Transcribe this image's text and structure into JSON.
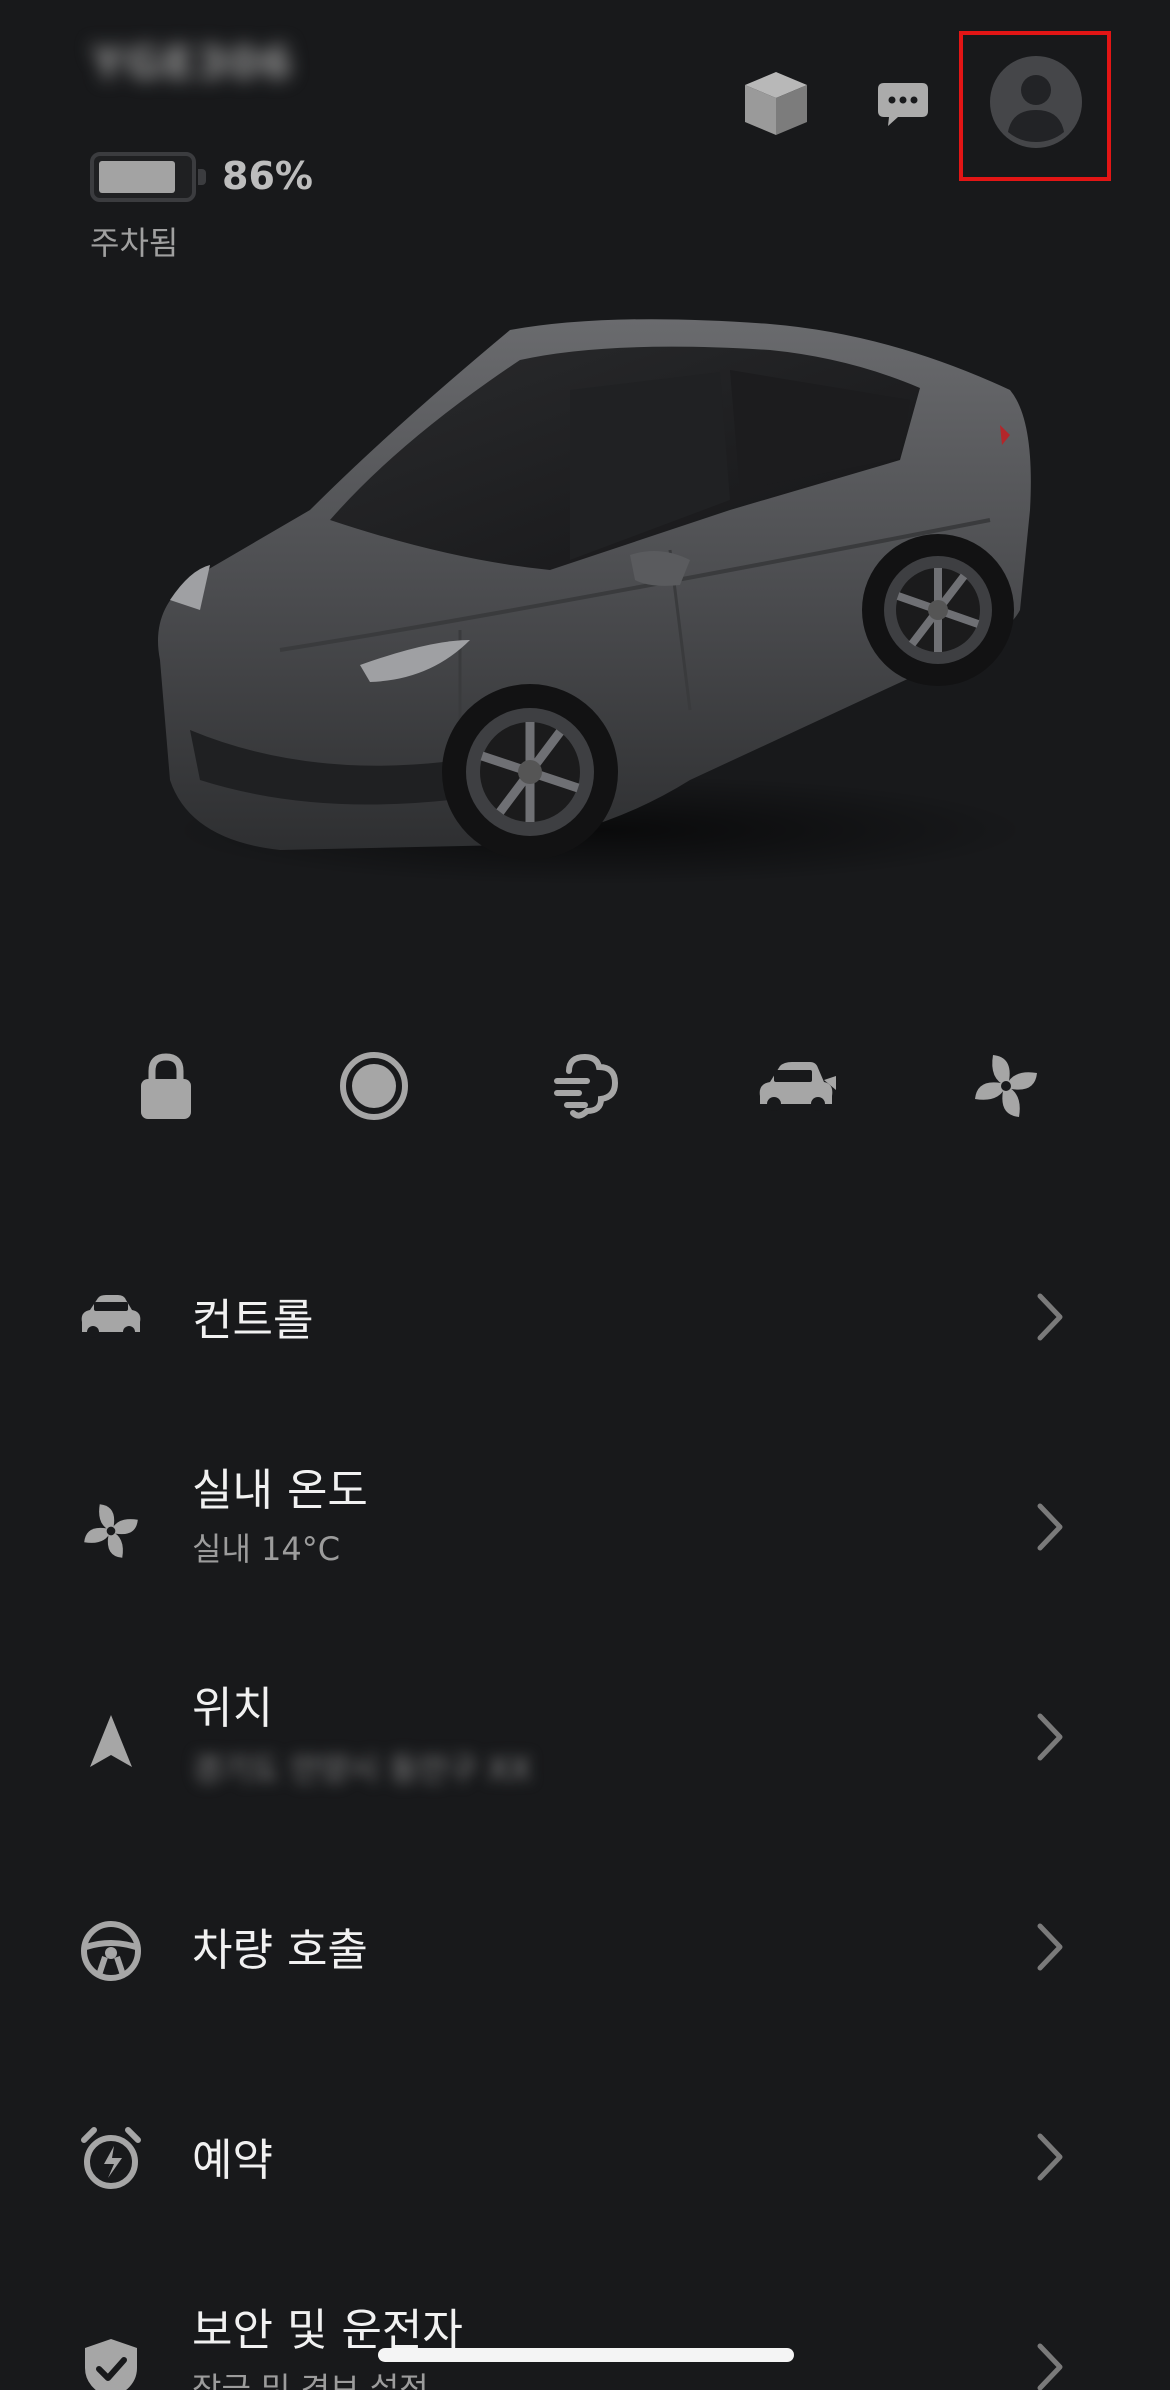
{
  "header": {
    "vehicle_name": "YGE306",
    "battery": {
      "percent_label": "86%",
      "level": 0.86
    },
    "status": "주차됨",
    "icons": [
      "cube-icon",
      "chat-bubble-icon",
      "profile-avatar-icon"
    ]
  },
  "quick_controls": [
    {
      "icon": "lock-icon"
    },
    {
      "icon": "record-button-icon"
    },
    {
      "icon": "defrost-icon"
    },
    {
      "icon": "frunk-icon"
    },
    {
      "icon": "fan-icon"
    }
  ],
  "menu": [
    {
      "icon": "car-icon",
      "title": "컨트롤",
      "subtitle": ""
    },
    {
      "icon": "fan-icon",
      "title": "실내 온도",
      "subtitle": "실내 14°C"
    },
    {
      "icon": "navigation-arrow-icon",
      "title": "위치",
      "subtitle": "경기도 안양시 동안구 XX"
    },
    {
      "icon": "steering-wheel-icon",
      "title": "차량 호출",
      "subtitle": ""
    },
    {
      "icon": "alarm-clock-icon",
      "title": "예약",
      "subtitle": ""
    },
    {
      "icon": "shield-icon",
      "title": "보안 및 운전자",
      "subtitle": "잠금 및 경보 설정"
    }
  ],
  "colors": {
    "background": "#18191b",
    "highlight": "#e21515",
    "icon_gray": "#a6a6a6"
  }
}
